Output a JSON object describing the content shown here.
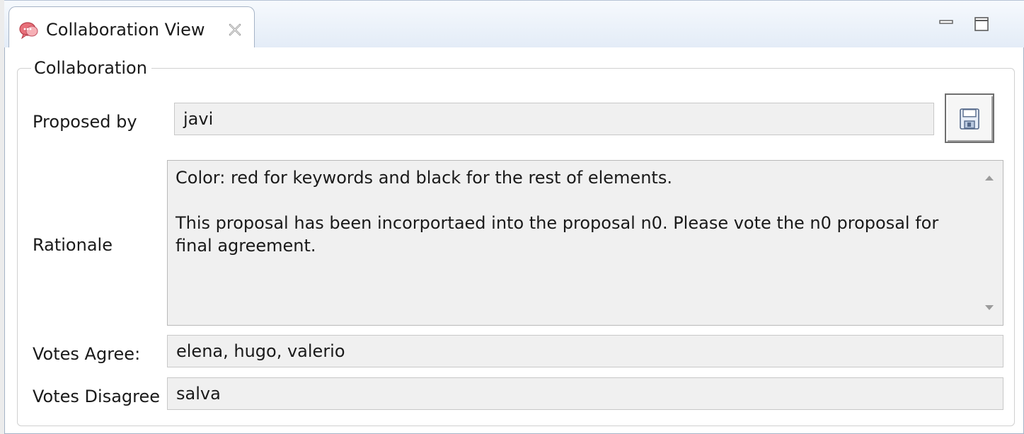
{
  "view": {
    "tab_title": "Collaboration View",
    "tab_icon": "collaboration-icon",
    "close_icon": "close-icon",
    "minimize_icon": "minimize-icon",
    "maximize_icon": "maximize-icon"
  },
  "group": {
    "title": "Collaboration"
  },
  "form": {
    "proposed_by_label": "Proposed by",
    "proposed_by_value": "javi",
    "rationale_label": "Rationale",
    "rationale_text": "Color: red for keywords and black for the rest of elements.\n\nThis proposal has been incorportaed into the proposal n0. Please vote the n0 proposal for final agreement.",
    "votes_agree_label": "Votes Agree:",
    "votes_agree_value": "elena, hugo, valerio",
    "votes_disagree_label": "Votes Disagree",
    "votes_disagree_value": "salva",
    "save_icon": "save-icon"
  }
}
